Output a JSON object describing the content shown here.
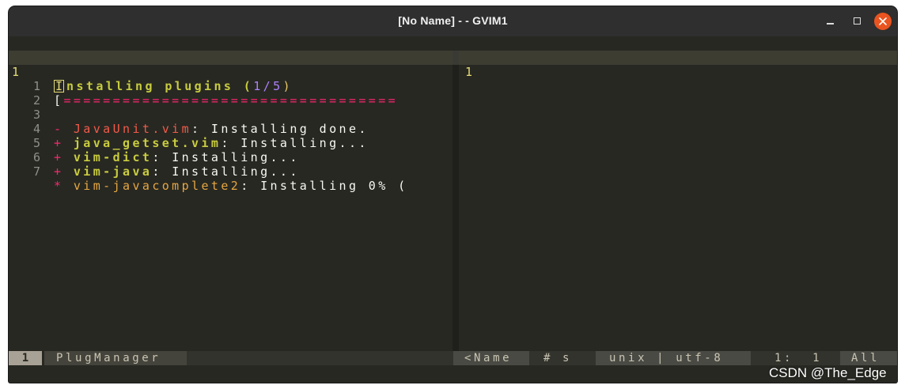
{
  "window": {
    "title": "[No Name] - - GVIM1",
    "controls": [
      "minimize-icon",
      "maximize-icon",
      "close-icon"
    ],
    "close_color": "#e95420"
  },
  "left_pane": {
    "lines": [
      {
        "number": "1",
        "parts": [
          "I",
          "nstalling plugins (",
          "1/5",
          ")"
        ]
      },
      {
        "number": "1",
        "parts": [
          "[",
          "=================================="
        ]
      },
      {
        "number": "2",
        "parts": []
      },
      {
        "number": "3",
        "parts": [
          "- ",
          "JavaUnit.vim",
          ": Installing done."
        ]
      },
      {
        "number": "4",
        "parts": [
          "+ ",
          "java_getset.vim",
          ": Installing..."
        ]
      },
      {
        "number": "5",
        "parts": [
          "+ ",
          "vim-dict",
          ": Installing..."
        ]
      },
      {
        "number": "6",
        "parts": [
          "+ ",
          "vim-java",
          ": Installing..."
        ]
      },
      {
        "number": "7",
        "parts": [
          "* ",
          "vim-javacomplete2",
          ": Installing 0% ("
        ]
      }
    ]
  },
  "right_pane": {
    "lines": [
      {
        "number": "1"
      }
    ]
  },
  "statusline": {
    "buffer_number": "1",
    "name": "PlugManager",
    "filetype": "<Name",
    "hash": "# s",
    "encoding": "unix | utf-8",
    "position": "1:  1",
    "percent": "All"
  },
  "watermark": "CSDN @The_Edge",
  "colors": {
    "background": "#272822",
    "cursorline": "#3e3d32",
    "accent_yellow": "#e6db74",
    "accent_pink": "#f92672",
    "accent_green": "#c9cc3f"
  }
}
